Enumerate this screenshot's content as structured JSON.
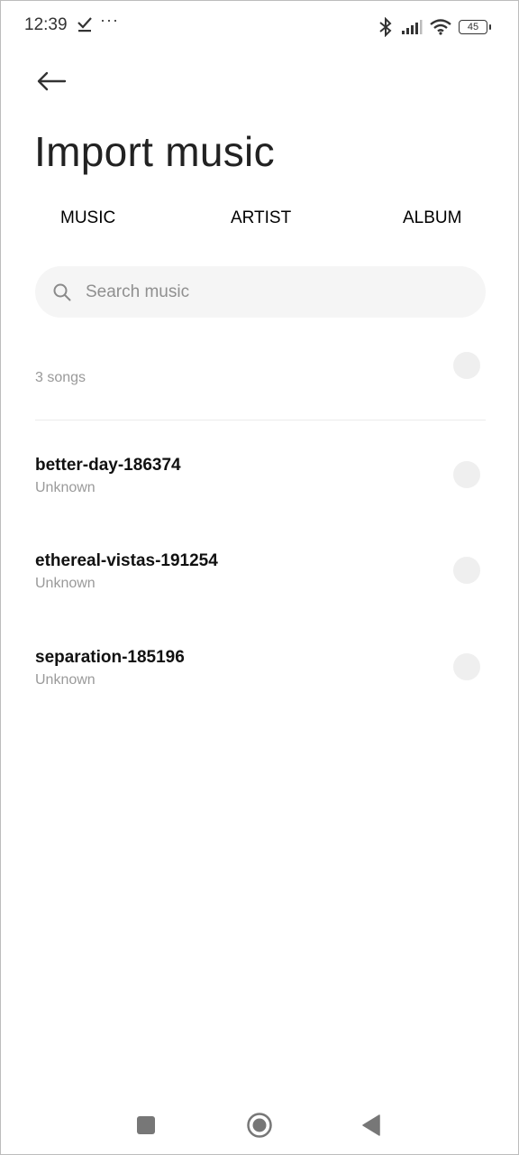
{
  "status_bar": {
    "time": "12:39",
    "dots": "···",
    "battery": "45",
    "icons": [
      "download-done-icon",
      "bluetooth-icon",
      "signal-icon",
      "wifi-icon",
      "battery-icon"
    ]
  },
  "header": {
    "title": "Import music",
    "back_icon": "arrow-left-icon"
  },
  "tabs": [
    {
      "label": "MUSIC"
    },
    {
      "label": "ARTIST"
    },
    {
      "label": "ALBUM"
    }
  ],
  "search": {
    "placeholder": "Search music",
    "value": ""
  },
  "list": {
    "count_label": "3 songs",
    "songs": [
      {
        "title": "better-day-186374",
        "artist": "Unknown",
        "selected": false
      },
      {
        "title": "ethereal-vistas-191254",
        "artist": "Unknown",
        "selected": false
      },
      {
        "title": "separation-185196",
        "artist": "Unknown",
        "selected": false
      }
    ]
  },
  "colors": {
    "radio_unselected": "#efefef",
    "search_bg": "#f5f5f5",
    "secondary_text": "#9a9a9a"
  },
  "nav_bar": {
    "buttons": [
      "recents",
      "home",
      "back"
    ]
  }
}
